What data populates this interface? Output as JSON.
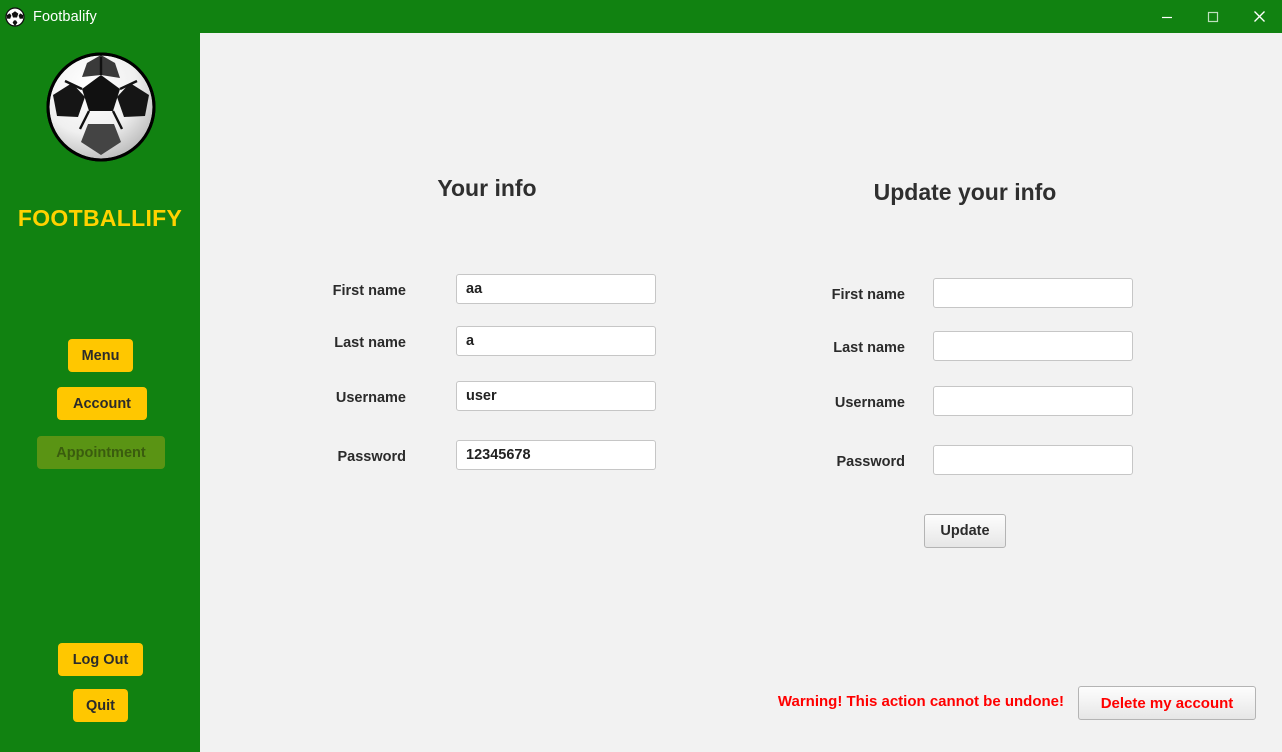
{
  "window": {
    "title": "Footbalify",
    "icon": "soccer-ball-icon",
    "titlebar_color": "#118211",
    "controls": {
      "minimize": "minimize-icon",
      "maximize": "maximize-icon",
      "close": "close-icon"
    }
  },
  "sidebar": {
    "brand": "FOOTBALLIFY",
    "logo": "soccer-ball-logo",
    "brand_color": "#ffd200",
    "background_color": "#118211",
    "button_color": "#ffc700",
    "nav_items": [
      {
        "label": "Menu",
        "disabled": false
      },
      {
        "label": "Account",
        "disabled": false
      },
      {
        "label": "Appointment",
        "disabled": true
      }
    ],
    "bottom_items": [
      {
        "label": "Log Out",
        "disabled": false
      },
      {
        "label": "Quit",
        "disabled": false
      }
    ]
  },
  "main": {
    "your_info": {
      "title": "Your info",
      "fields": [
        {
          "label": "First name",
          "value": "aa"
        },
        {
          "label": "Last name",
          "value": "a"
        },
        {
          "label": "Username",
          "value": "user"
        },
        {
          "label": "Password",
          "value": "12345678"
        }
      ]
    },
    "update_info": {
      "title": "Update your info",
      "fields": [
        {
          "label": "First name",
          "value": ""
        },
        {
          "label": "Last name",
          "value": ""
        },
        {
          "label": "Username",
          "value": ""
        },
        {
          "label": "Password",
          "value": ""
        }
      ],
      "submit_label": "Update"
    },
    "danger_zone": {
      "warning": "Warning! This action cannot be undone!",
      "warning_color": "#ff0000",
      "delete_label": "Delete my account"
    }
  }
}
